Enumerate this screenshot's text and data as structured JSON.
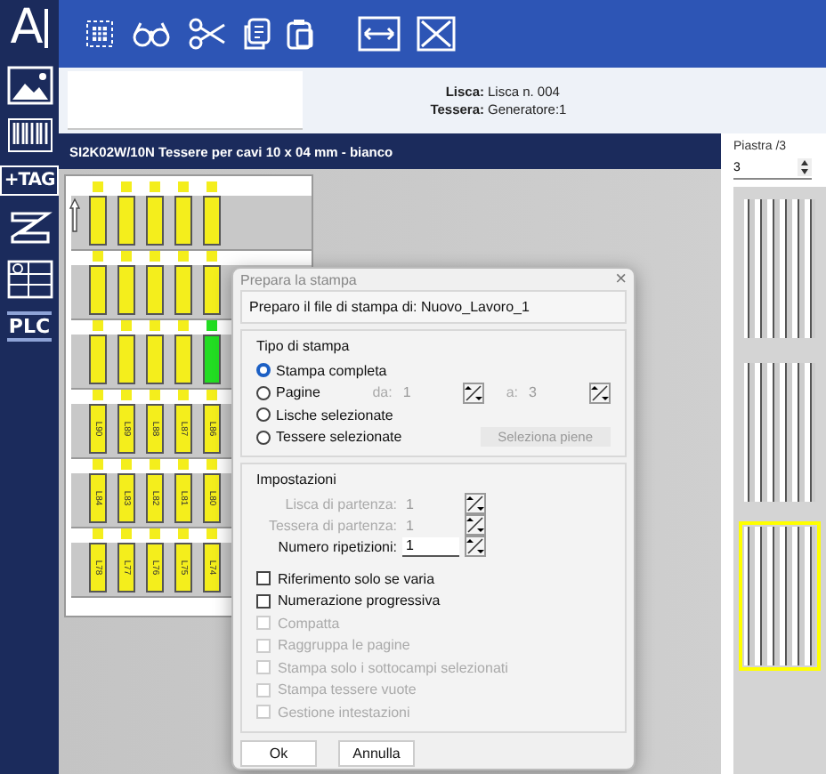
{
  "sidebar": {
    "text_tool": "A",
    "tag_label": "+TAG",
    "plc_label": "PLC"
  },
  "info": {
    "lisca_label": "Lisca:",
    "lisca_value": "Lisca n. 004",
    "tessera_label": "Tessera:",
    "tessera_value": "Generatore:1"
  },
  "product_header": "SI2K02W/10N Tessere per cavi 10 x 04 mm - bianco",
  "sheet": {
    "rows": [
      {
        "tiles": [
          {
            "color": "#f4ee1c"
          },
          {
            "color": "#f4ee1c"
          },
          {
            "color": "#f4ee1c"
          },
          {
            "color": "#f4ee1c"
          },
          {
            "color": "#f4ee1c"
          }
        ]
      },
      {
        "tiles": [
          {
            "color": "#f4ee1c"
          },
          {
            "color": "#f4ee1c"
          },
          {
            "color": "#f4ee1c"
          },
          {
            "color": "#f4ee1c"
          },
          {
            "color": "#f4ee1c"
          }
        ]
      },
      {
        "tiles": [
          {
            "color": "#f4ee1c"
          },
          {
            "color": "#f4ee1c"
          },
          {
            "color": "#f4ee1c"
          },
          {
            "color": "#f4ee1c"
          },
          {
            "color": "#22dd22"
          }
        ]
      },
      {
        "tiles": [
          {
            "color": "#f4ee1c",
            "label": "L90"
          },
          {
            "color": "#f4ee1c",
            "label": "L89"
          },
          {
            "color": "#f4ee1c",
            "label": "L88"
          },
          {
            "color": "#f4ee1c",
            "label": "L87"
          },
          {
            "color": "#f4ee1c",
            "label": "L86"
          }
        ]
      },
      {
        "tiles": [
          {
            "color": "#f4ee1c",
            "label": "L84"
          },
          {
            "color": "#f4ee1c",
            "label": "L83"
          },
          {
            "color": "#f4ee1c",
            "label": "L82"
          },
          {
            "color": "#f4ee1c",
            "label": "L81"
          },
          {
            "color": "#f4ee1c",
            "label": "L80"
          }
        ]
      },
      {
        "tiles": [
          {
            "color": "#f4ee1c",
            "label": "L78"
          },
          {
            "color": "#f4ee1c",
            "label": "L77"
          },
          {
            "color": "#f4ee1c",
            "label": "L76"
          },
          {
            "color": "#f4ee1c",
            "label": "L75"
          },
          {
            "color": "#f4ee1c",
            "label": "L74"
          }
        ]
      }
    ]
  },
  "plate_panel": {
    "title": "Piastra /3",
    "value": "3",
    "plates": [
      {
        "selected": false
      },
      {
        "selected": false
      },
      {
        "selected": true
      }
    ]
  },
  "dialog": {
    "title": "Prepara la stampa",
    "close": "×",
    "message": "Preparo il file di stampa di: Nuovo_Lavoro_1",
    "print_type": {
      "title": "Tipo di stampa",
      "options": [
        {
          "label": "Stampa completa",
          "selected": true
        },
        {
          "label": "Pagine",
          "selected": false
        },
        {
          "label": "Lische selezionate",
          "selected": false
        },
        {
          "label": "Tessere selezionate",
          "selected": false
        }
      ],
      "range": {
        "from_label": "da:",
        "from_value": "1",
        "to_label": "a:",
        "to_value": "3",
        "disabled": true
      },
      "select_full_button": {
        "label": "Seleziona piene",
        "disabled": true
      }
    },
    "settings": {
      "title": "Impostazioni",
      "fields": [
        {
          "label": "Lisca di partenza:",
          "value": "1",
          "disabled": true
        },
        {
          "label": "Tessera di partenza:",
          "value": "1",
          "disabled": true
        },
        {
          "label": "Numero ripetizioni:",
          "value": "1",
          "disabled": false
        }
      ],
      "checkboxes": [
        {
          "label": "Riferimento solo se varia",
          "checked": false,
          "disabled": false
        },
        {
          "label": "Numerazione progressiva",
          "checked": false,
          "disabled": false
        },
        {
          "label": "Compatta",
          "checked": false,
          "disabled": true
        },
        {
          "label": "Raggruppa le pagine",
          "checked": false,
          "disabled": true
        },
        {
          "label": "Stampa solo i sottocampi selezionati",
          "checked": false,
          "disabled": true
        },
        {
          "label": "Stampa tessere vuote",
          "checked": false,
          "disabled": true
        },
        {
          "label": "Gestione intestazioni",
          "checked": false,
          "disabled": true
        }
      ]
    },
    "buttons": [
      "Ok",
      "Annulla"
    ]
  }
}
